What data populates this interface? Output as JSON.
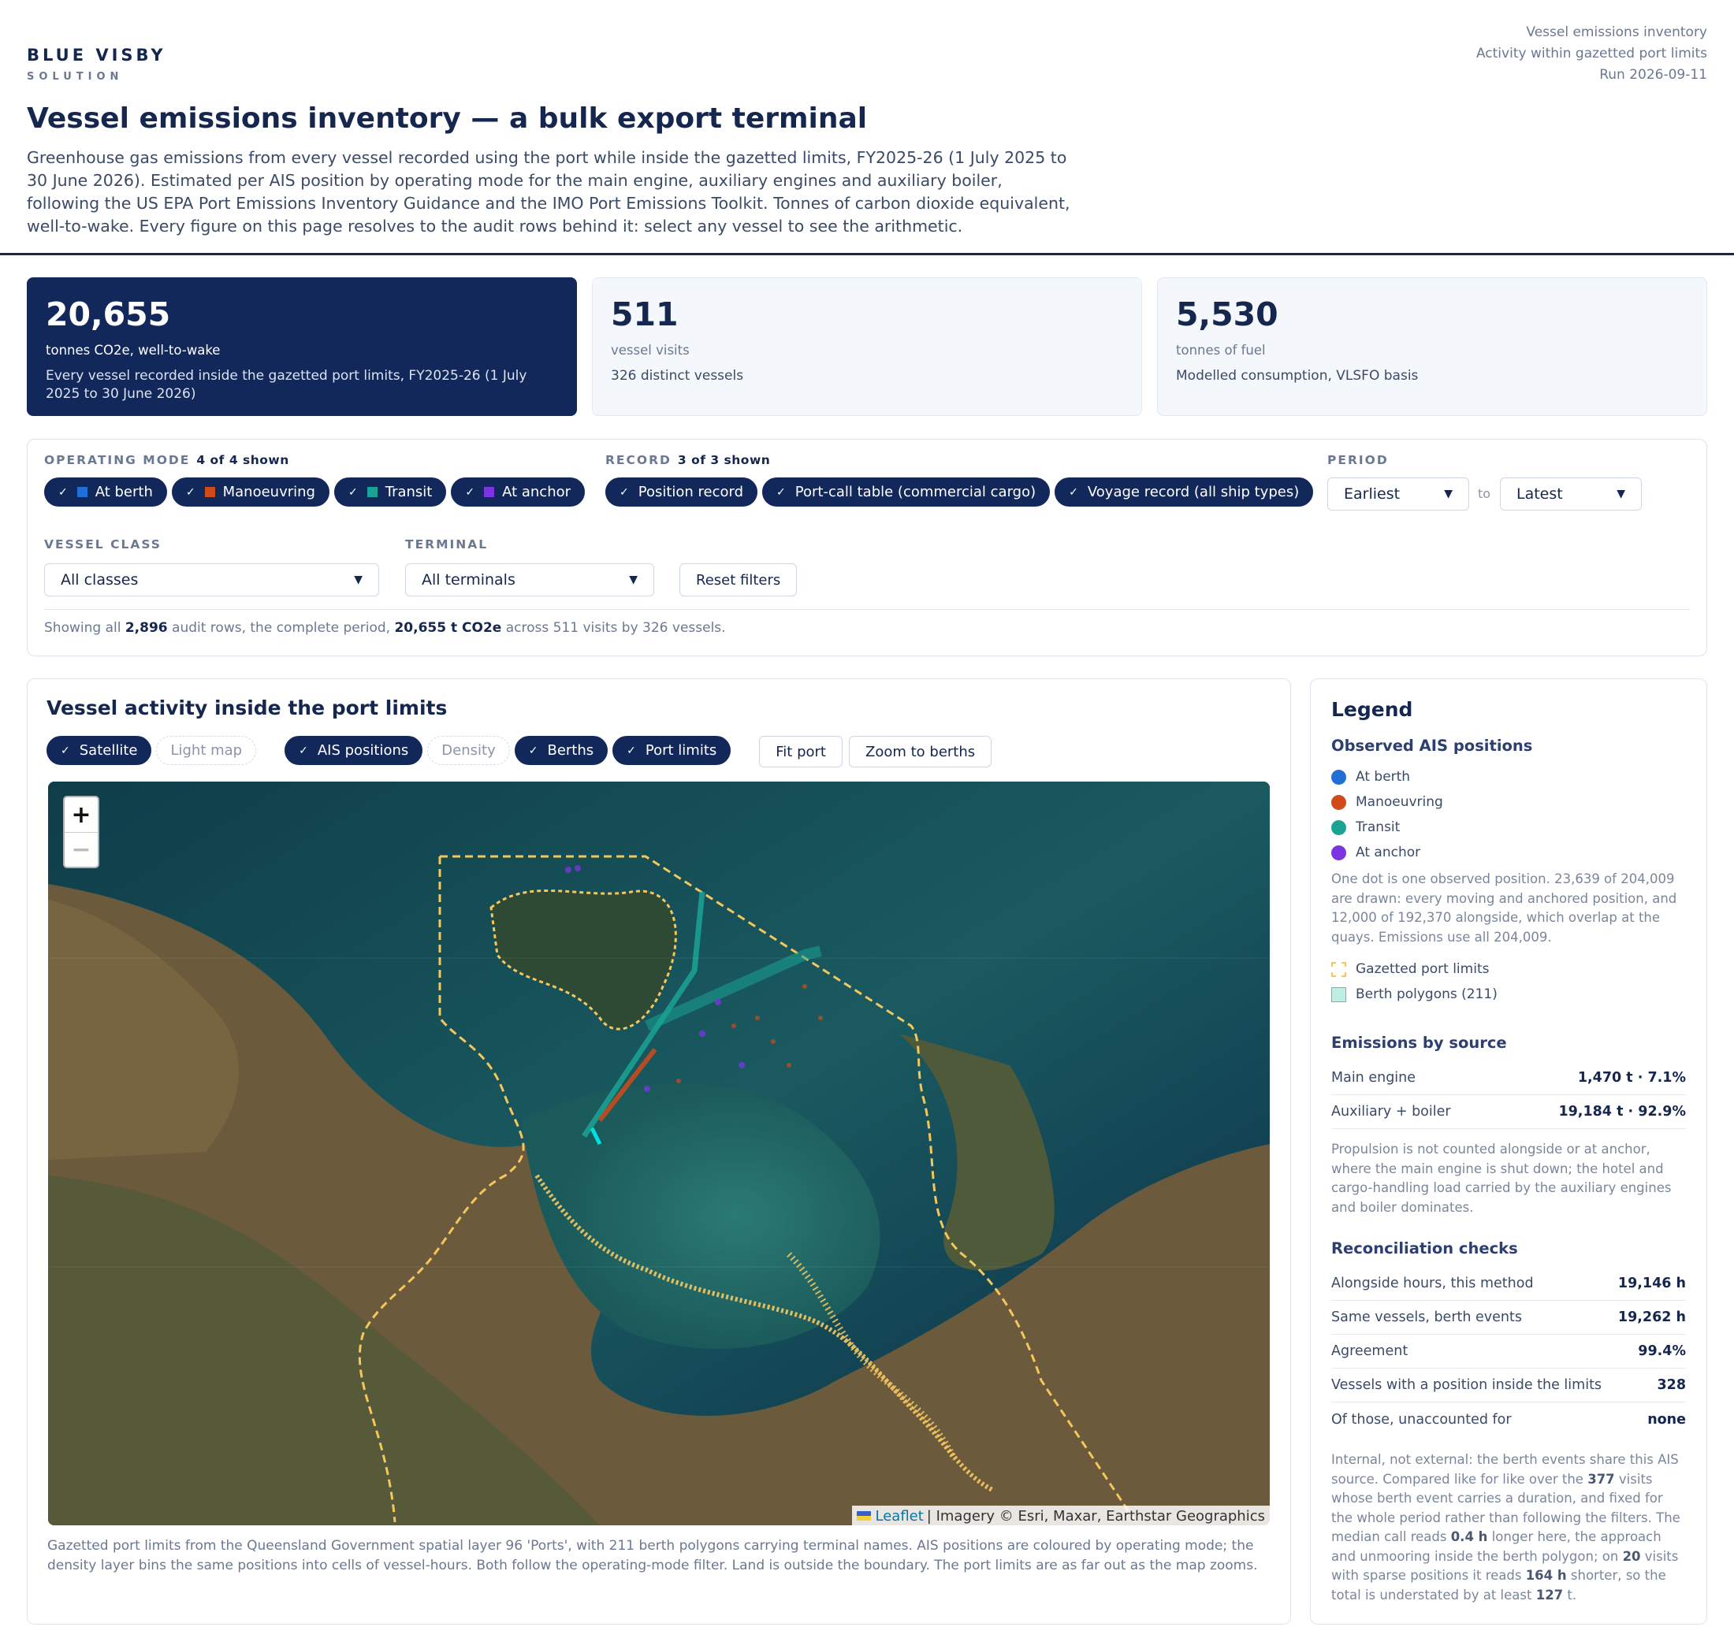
{
  "brand": {
    "name": "BLUE VISBY",
    "sub": "SOLUTION"
  },
  "meta": [
    "Vessel emissions inventory",
    "Activity within gazetted port limits",
    "Run 2026-09-11"
  ],
  "title": "Vessel emissions inventory — a bulk export terminal",
  "description": "Greenhouse gas emissions from every vessel recorded using the port while inside the gazetted limits, FY2025-26 (1 July 2025 to 30 June 2026). Estimated per AIS position by operating mode for the main engine, auxiliary engines and auxiliary boiler, following the US EPA Port Emissions Inventory Guidance and the IMO Port Emissions Toolkit. Tonnes of carbon dioxide equivalent, well-to-wake. Every figure on this page resolves to the audit rows behind it: select any vessel to see the arithmetic.",
  "kpis": [
    {
      "value": "20,655",
      "unit": "tonnes CO2e, well-to-wake",
      "sub": "Every vessel recorded inside the gazetted port limits, FY2025-26 (1 July 2025 to 30 June 2026)"
    },
    {
      "value": "511",
      "unit": "vessel visits",
      "sub": "326 distinct vessels"
    },
    {
      "value": "5,530",
      "unit": "tonnes of fuel",
      "sub": "Modelled consumption, VLSFO basis"
    }
  ],
  "filters": {
    "operating_mode": {
      "label": "OPERATING MODE",
      "count": "4 of 4 shown",
      "chips": [
        {
          "label": "At berth",
          "color": "#1f6fd6"
        },
        {
          "label": "Manoeuvring",
          "color": "#d04a1a"
        },
        {
          "label": "Transit",
          "color": "#1aa394"
        },
        {
          "label": "At anchor",
          "color": "#7b35e0"
        }
      ]
    },
    "record": {
      "label": "RECORD",
      "count": "3 of 3 shown",
      "chips": [
        "Position record",
        "Port-call table (commercial cargo)",
        "Voyage record (all ship types)"
      ]
    },
    "period": {
      "label": "PERIOD",
      "from": "Earliest",
      "to_label": "to",
      "to": "Latest"
    },
    "vessel_class": {
      "label": "VESSEL CLASS",
      "value": "All classes"
    },
    "terminal": {
      "label": "TERMINAL",
      "value": "All terminals"
    },
    "reset": "Reset filters",
    "summary": {
      "pre": "Showing all ",
      "rows": "2,896",
      "mid": " audit rows, the complete period, ",
      "total": "20,655 t CO2e",
      "post": " across 511 visits by 326 vessels."
    }
  },
  "map": {
    "title": "Vessel activity inside the port limits",
    "toggles": [
      {
        "label": "Satellite",
        "on": true
      },
      {
        "label": "Light map",
        "on": false
      },
      {
        "label": "AIS positions",
        "on": true
      },
      {
        "label": "Density",
        "on": false
      },
      {
        "label": "Berths",
        "on": true
      },
      {
        "label": "Port limits",
        "on": true
      }
    ],
    "buttons": [
      "Fit port",
      "Zoom to berths"
    ],
    "zoom_in": "+",
    "zoom_out": "−",
    "attribution": {
      "leaflet": "Leaflet",
      "text": "| Imagery © Esri, Maxar, Earthstar Geographics"
    },
    "caption": "Gazetted port limits from the Queensland Government spatial layer 96 'Ports', with 211 berth polygons carrying terminal names. AIS positions are coloured by operating mode; the density layer bins the same positions into cells of vessel-hours. Both follow the operating-mode filter. Land is outside the boundary. The port limits are as far out as the map zooms."
  },
  "legend": {
    "title": "Legend",
    "observed": {
      "title": "Observed AIS positions",
      "items": [
        {
          "label": "At berth",
          "color": "#1f6fd6"
        },
        {
          "label": "Manoeuvring",
          "color": "#d04a1a"
        },
        {
          "label": "Transit",
          "color": "#1aa394"
        },
        {
          "label": "At anchor",
          "color": "#7b35e0"
        }
      ],
      "note": "One dot is one observed position. 23,639 of 204,009 are drawn: every moving and anchored position, and 12,000 of 192,370 alongside, which overlap at the quays. Emissions use all 204,009."
    },
    "limits_label": "Gazetted port limits",
    "berths_label": "Berth polygons (211)",
    "by_source": {
      "title": "Emissions by source",
      "rows": [
        {
          "label": "Main engine",
          "value": "1,470 t · 7.1%"
        },
        {
          "label": "Auxiliary + boiler",
          "value": "19,184 t · 92.9%"
        }
      ],
      "note": "Propulsion is not counted alongside or at anchor, where the main engine is shut down; the hotel and cargo-handling load carried by the auxiliary engines and boiler dominates."
    },
    "recon": {
      "title": "Reconciliation checks",
      "rows": [
        {
          "label": "Alongside hours, this method",
          "value": "19,146 h"
        },
        {
          "label": "Same vessels, berth events",
          "value": "19,262 h"
        },
        {
          "label": "Agreement",
          "value": "99.4%"
        },
        {
          "label": "Vessels with a position inside the limits",
          "value": "328"
        },
        {
          "label": "Of those, unaccounted for",
          "value": "none"
        }
      ],
      "note": {
        "a": "Internal, not external: the berth events share this AIS source. Compared like for like over the ",
        "b": "377",
        "c": " visits whose berth event carries a duration, and fixed for the whole period rather than following the filters. The median call reads ",
        "d": "0.4 h",
        "e": " longer here, the approach and unmooring inside the berth polygon; on ",
        "f": "20",
        "g": " visits with sparse positions it reads ",
        "h": "164 h",
        "i": " shorter, so the total is understated by at least ",
        "j": "127",
        "k": " t."
      }
    }
  },
  "colors": {
    "navy": "#13285a",
    "limits": "#f5c65a",
    "berth": "#7fd6c8"
  }
}
